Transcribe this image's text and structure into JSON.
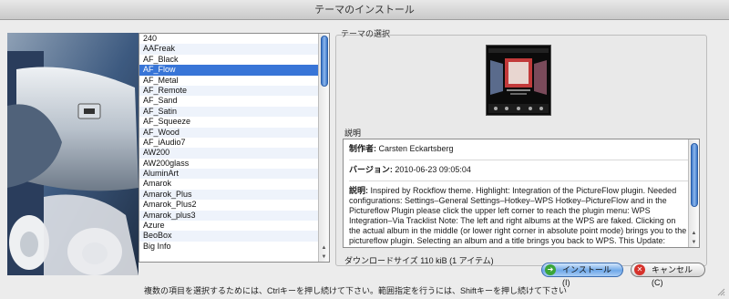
{
  "window": {
    "title": "テーマのインストール"
  },
  "theme_list": {
    "items": [
      "240",
      "AAFreak",
      "AF_Black",
      "AF_Flow",
      "AF_Metal",
      "AF_Remote",
      "AF_Sand",
      "AF_Satin",
      "AF_Squeeze",
      "AF_Wood",
      "AF_iAudio7",
      "AW200",
      "AW200glass",
      "AluminArt",
      "Amarok",
      "Amarok_Plus",
      "Amarok_Plus2",
      "Amarok_plus3",
      "Azure",
      "BeoBox",
      "Big Info"
    ],
    "selected": "AF_Flow"
  },
  "theme_details": {
    "group_title": "テーマの選択",
    "description_label": "説明",
    "author_label": "制作者:",
    "author": "Carsten Eckartsberg",
    "version_label": "バージョン:",
    "version": "2010-06-23 09:05:04",
    "explanation_label": "説明:",
    "explanation": "Inspired by Rockflow theme. Highlight: Integration of the PictureFlow plugin. Needed configurations: Settings–General Settings–Hotkey–WPS Hotkey–PictureFlow and in the Pictureflow Plugin please click the upper left corner to reach the plugin menu: WPS Integration–Via Tracklist Note: The left and right albums at the WPS are faked. Clicking on the actual album in the middle (or lower right corner in absolute point mode) brings you to the pictureflow plugin. Selecting an album and a title brings you back to WPS. This Update: Screen related buttons, FM Screen, changed albums left and right and some optical corrections. Take",
    "download_size": "ダウンロードサイズ 110 kiB (1 アイテム)"
  },
  "status_text": "複数の項目を選択するためには、Ctrlキーを押し続けて下さい。範囲指定を行うには、Shiftキーを押し続けて下さい",
  "buttons": {
    "install": "インストール(I)",
    "cancel": "キャンセル(C)"
  },
  "icons": {
    "install": "install-arrow-icon",
    "cancel": "cancel-x-icon"
  },
  "colors": {
    "selection": "#3875d7",
    "default_button": "#6fa8e8",
    "cancel_icon": "#d6322b",
    "install_icon": "#3aa53a"
  }
}
